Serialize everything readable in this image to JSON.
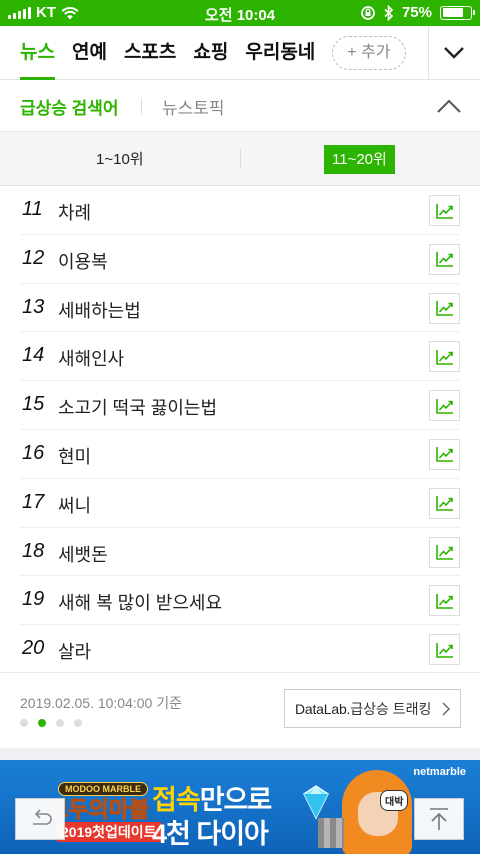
{
  "status_bar": {
    "carrier": "KT",
    "time": "오전 10:04",
    "battery_percent": "75%",
    "battery_level": 0.75
  },
  "top_nav": {
    "tabs": [
      {
        "label": "뉴스",
        "active": true
      },
      {
        "label": "연예",
        "active": false
      },
      {
        "label": "스포츠",
        "active": false
      },
      {
        "label": "쇼핑",
        "active": false
      },
      {
        "label": "우리동네",
        "active": false
      }
    ],
    "add_label": "+ 추가",
    "expand_icon": "chevron-down-icon"
  },
  "section": {
    "title": "급상승 검색어",
    "subtitle": "뉴스토픽",
    "collapse_icon": "chevron-up-icon"
  },
  "range_tabs": [
    {
      "label": "1~10위",
      "active": false
    },
    {
      "label": "11~20위",
      "active": true
    }
  ],
  "keywords": [
    {
      "rank": "11",
      "keyword": "차례"
    },
    {
      "rank": "12",
      "keyword": "이용복"
    },
    {
      "rank": "13",
      "keyword": "세배하는법"
    },
    {
      "rank": "14",
      "keyword": "새해인사"
    },
    {
      "rank": "15",
      "keyword": "소고기 떡국 끓이는법"
    },
    {
      "rank": "16",
      "keyword": "현미"
    },
    {
      "rank": "17",
      "keyword": "써니"
    },
    {
      "rank": "18",
      "keyword": "세뱃돈"
    },
    {
      "rank": "19",
      "keyword": "새해 복 많이 받으세요"
    },
    {
      "rank": "20",
      "keyword": "살라"
    }
  ],
  "footer": {
    "timestamp": "2019.02.05. 10:04:00 기준",
    "datalab_brand": "DataLab.",
    "datalab_label": "급상승 트래킹",
    "page_dots": 4,
    "active_dot": 1
  },
  "ad": {
    "brand": "netmarble",
    "game_badge": "MODOO MARBLE",
    "game_name": "모두의마블",
    "update_label": "2019첫업데이트",
    "headline_highlight": "접속",
    "headline_rest": "만으로",
    "headline_line2": "4천 다이아",
    "bubble": "대박"
  },
  "colors": {
    "accent": "#2db400",
    "status_bar": "#2db400",
    "ad_bg": "#1b7fd6"
  }
}
